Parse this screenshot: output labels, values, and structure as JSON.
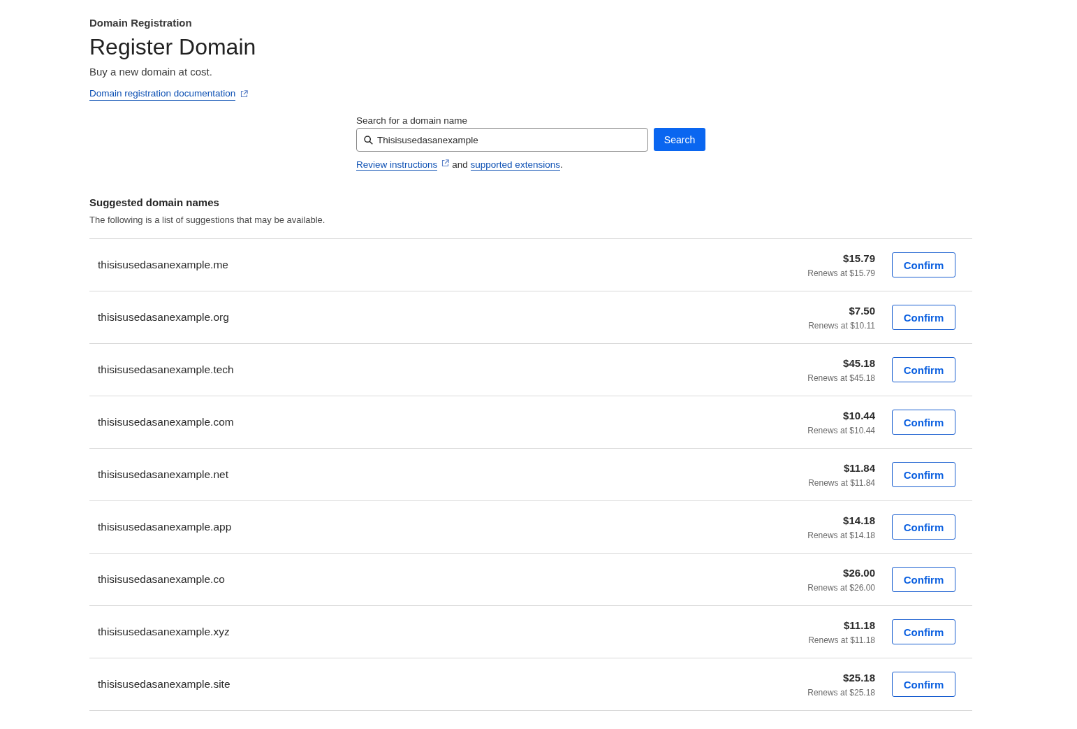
{
  "header": {
    "eyebrow": "Domain Registration",
    "title": "Register Domain",
    "subtitle": "Buy a new domain at cost.",
    "doc_link": "Domain registration documentation"
  },
  "search": {
    "label": "Search for a domain name",
    "value": "Thisisusedasanexample",
    "button": "Search",
    "help": {
      "link_1": "Review instructions",
      "joiner": "and",
      "link_2": "supported extensions",
      "end": "."
    }
  },
  "suggestions": {
    "title": "Suggested domain names",
    "description": "The following is a list of suggestions that may be available.",
    "rows": [
      {
        "domain": "thisisusedasanexample.me",
        "price": "$15.79",
        "renewal": "Renews at $15.79",
        "action": "Confirm"
      },
      {
        "domain": "thisisusedasanexample.org",
        "price": "$7.50",
        "renewal": "Renews at $10.11",
        "action": "Confirm"
      },
      {
        "domain": "thisisusedasanexample.tech",
        "price": "$45.18",
        "renewal": "Renews at $45.18",
        "action": "Confirm"
      },
      {
        "domain": "thisisusedasanexample.com",
        "price": "$10.44",
        "renewal": "Renews at $10.44",
        "action": "Confirm"
      },
      {
        "domain": "thisisusedasanexample.net",
        "price": "$11.84",
        "renewal": "Renews at $11.84",
        "action": "Confirm"
      },
      {
        "domain": "thisisusedasanexample.app",
        "price": "$14.18",
        "renewal": "Renews at $14.18",
        "action": "Confirm"
      },
      {
        "domain": "thisisusedasanexample.co",
        "price": "$26.00",
        "renewal": "Renews at $26.00",
        "action": "Confirm"
      },
      {
        "domain": "thisisusedasanexample.xyz",
        "price": "$11.18",
        "renewal": "Renews at $11.18",
        "action": "Confirm"
      },
      {
        "domain": "thisisusedasanexample.site",
        "price": "$25.18",
        "renewal": "Renews at $25.18",
        "action": "Confirm"
      }
    ]
  }
}
